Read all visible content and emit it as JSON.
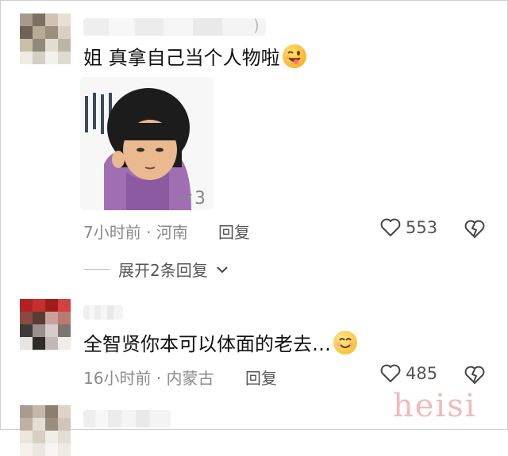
{
  "comments": [
    {
      "text": "姐 真拿自己当个人物啦",
      "emoji": "wink-tongue-emoji",
      "sticker": "shocked-girl-sticker",
      "time": "7小时前",
      "location": "河南",
      "reply_label": "回复",
      "likes": "553",
      "expand_label": "展开2条回复"
    },
    {
      "text": "全智贤你本可以体面的老去…",
      "emoji": "smile-emoji",
      "time": "16小时前",
      "location": "内蒙古",
      "reply_label": "回复",
      "likes": "485"
    }
  ],
  "meta_separator": "·",
  "name_tail": ")",
  "watermark": "heisi",
  "colors": {
    "meta_text": "#8a8a8a",
    "watermark": "#f3b9b9",
    "background": "#ffffff"
  }
}
